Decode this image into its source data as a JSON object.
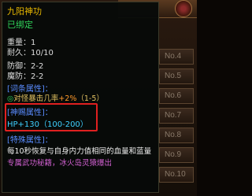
{
  "inventory": {
    "slots": [
      "No.4",
      "No.5",
      "No.6",
      "No.7",
      "No.8",
      "No.9",
      "No.10"
    ]
  },
  "tooltip": {
    "title": "九阳神功",
    "bound": "已绑定",
    "weight": "重量：1",
    "durability": "耐久：10/10",
    "defense": "防御：2-2",
    "magic_defense": "魔防：2-2",
    "affix_header": "[词条属性]：",
    "affix_bullet": "◎",
    "affix_text": "对怪暴击几率",
    "affix_value": "+2%",
    "affix_range": "（1-5）",
    "divine_header": "[神赐属性]：",
    "divine_text": "HP+130（100-200）",
    "special_header": "[特殊属性]：",
    "special_text": "每10秒恢复与自身内力值相同的血量和蓝量",
    "exclusive_text": "专属武功秘籍，冰火岛灵猿爆出"
  },
  "colors": {
    "title": "#e8b800",
    "bound": "#2fd35a",
    "section_header": "#5a8cff",
    "divine_value": "#3fd0ff",
    "exclusive": "#d060d0",
    "highlight_box": "#e02020"
  }
}
